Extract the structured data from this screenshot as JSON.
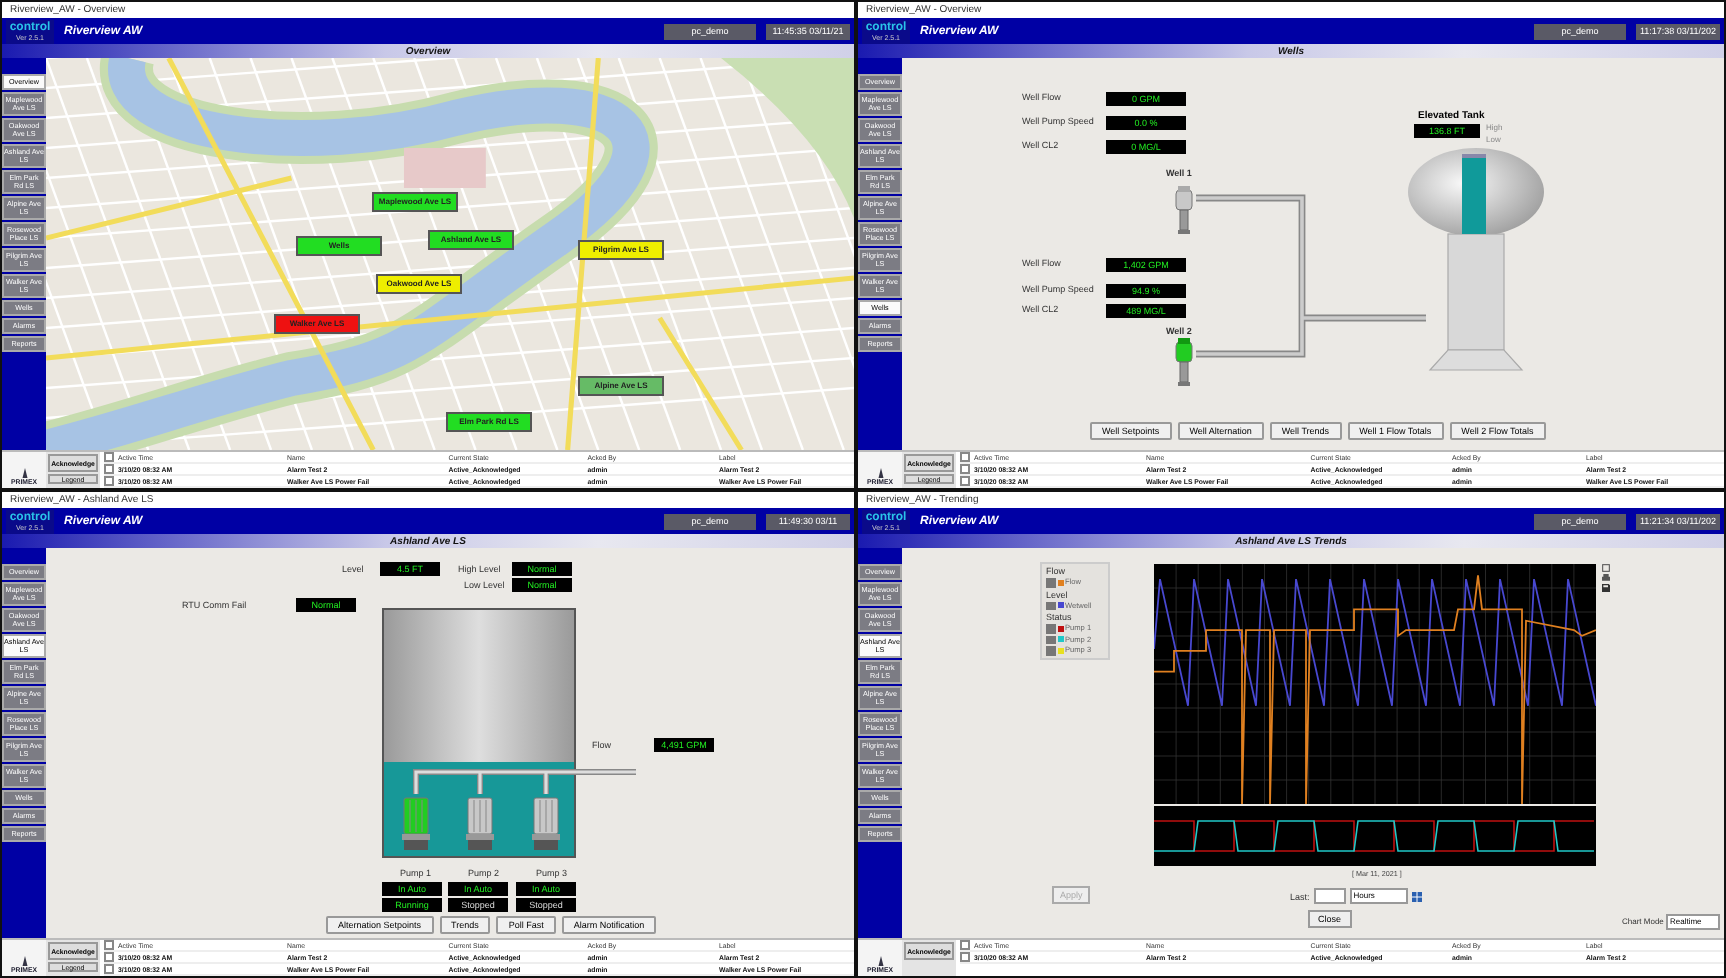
{
  "panels": [
    {
      "window_title": "Riverview_AW - Overview",
      "logo": "control",
      "version": "Ver 2.5.1",
      "app_title": "Riverview AW",
      "user": "pc_demo",
      "clock": "11:45:35  03/11/21",
      "screen_title": "Overview",
      "select_all_checked": false,
      "nav": [
        {
          "label": "Overview",
          "selected": true
        },
        {
          "label": "Maplewood Ave LS",
          "selected": false
        },
        {
          "label": "Oakwood Ave LS",
          "selected": false
        },
        {
          "label": "Ashland Ave LS",
          "selected": false
        },
        {
          "label": "Elm Park Rd LS",
          "selected": false
        },
        {
          "label": "Alpine Ave LS",
          "selected": false
        },
        {
          "label": "Rosewood Place LS",
          "selected": false
        },
        {
          "label": "Pilgrim Ave LS",
          "selected": false
        },
        {
          "label": "Walker Ave LS",
          "selected": false
        },
        {
          "label": "Wells",
          "selected": false
        },
        {
          "label": "Alarms",
          "selected": false
        },
        {
          "label": "Reports",
          "selected": false
        }
      ],
      "content": {
        "kind": "map",
        "stations": [
          {
            "label": "Maplewood Ave LS",
            "color": "#22dd22"
          },
          {
            "label": "Wells",
            "color": "#22dd22"
          },
          {
            "label": "Ashland Ave LS",
            "color": "#22dd22"
          },
          {
            "label": "Oakwood Ave LS",
            "color": "#eeee00"
          },
          {
            "label": "Pilgrim Ave LS",
            "color": "#eeee00"
          },
          {
            "label": "Walker Ave LS",
            "color": "#ee1111"
          },
          {
            "label": "Alpine Ave LS",
            "color": "#66bb66"
          },
          {
            "label": "Elm Park Rd LS",
            "color": "#22dd22"
          }
        ]
      },
      "brand": "PRIMEX",
      "alarm_buttons": [
        "Acknowledge",
        "Legend"
      ],
      "alarm_columns": [
        "Active Time",
        "Name",
        "Current State",
        "Acked By",
        "Label"
      ],
      "alarm_rows": [
        {
          "checked": false,
          "cells": [
            "3/10/20 08:32 AM",
            "Alarm Test 2",
            "Active_Acknowledged",
            "admin",
            "Alarm Test 2"
          ]
        },
        {
          "checked": false,
          "cells": [
            "3/10/20 08:32 AM",
            "Walker Ave LS Power Fail",
            "Active_Acknowledged",
            "admin",
            "Walker Ave LS Power Fail"
          ]
        }
      ]
    },
    {
      "window_title": "Riverview_AW - Overview",
      "logo": "control",
      "version": "Ver 2.5.1",
      "app_title": "Riverview AW",
      "user": "pc_demo",
      "clock": "11:17:38  03/11/202",
      "screen_title": "Wells",
      "select_all_checked": false,
      "nav": [
        {
          "label": "Overview",
          "selected": false
        },
        {
          "label": "Maplewood Ave LS",
          "selected": false
        },
        {
          "label": "Oakwood Ave LS",
          "selected": false
        },
        {
          "label": "Ashland Ave LS",
          "selected": false
        },
        {
          "label": "Elm Park Rd LS",
          "selected": false
        },
        {
          "label": "Alpine Ave LS",
          "selected": false
        },
        {
          "label": "Rosewood Place LS",
          "selected": false
        },
        {
          "label": "Pilgrim Ave LS",
          "selected": false
        },
        {
          "label": "Walker Ave LS",
          "selected": false
        },
        {
          "label": "Wells",
          "selected": true
        },
        {
          "label": "Alarms",
          "selected": false
        },
        {
          "label": "Reports",
          "selected": false
        }
      ],
      "content": {
        "kind": "wells",
        "wells": [
          {
            "name": "Well 1",
            "running": false,
            "readings": [
              {
                "label": "Well Flow",
                "value": "0 GPM"
              },
              {
                "label": "Well Pump Speed",
                "value": "0.0 %"
              },
              {
                "label": "Well CL2",
                "value": "0 MG/L"
              }
            ]
          },
          {
            "name": "Well 2",
            "running": true,
            "readings": [
              {
                "label": "Well Flow",
                "value": "1,402 GPM"
              },
              {
                "label": "Well Pump Speed",
                "value": "94.9 %"
              },
              {
                "label": "Well CL2",
                "value": "489 MG/L"
              }
            ]
          }
        ],
        "tank": {
          "title": "Elevated Tank",
          "value": "136.8 FT",
          "high": "High",
          "low": "Low",
          "level": 0.95
        },
        "buttons": [
          "Well Setpoints",
          "Well Alternation",
          "Well Trends",
          "Well 1 Flow Totals",
          "Well 2 Flow Totals"
        ]
      },
      "brand": "PRIMEX",
      "alarm_buttons": [
        "Acknowledge",
        "Legend"
      ],
      "alarm_columns": [
        "Active Time",
        "Name",
        "Current State",
        "Acked By",
        "Label"
      ],
      "alarm_rows": [
        {
          "checked": false,
          "cells": [
            "3/10/20 08:32 AM",
            "Alarm Test 2",
            "Active_Acknowledged",
            "admin",
            "Alarm Test 2"
          ]
        },
        {
          "checked": false,
          "cells": [
            "3/10/20 08:32 AM",
            "Walker Ave LS Power Fail",
            "Active_Acknowledged",
            "admin",
            "Walker Ave LS Power Fail"
          ]
        }
      ]
    },
    {
      "window_title": "Riverview_AW - Ashland Ave LS",
      "logo": "control",
      "version": "Ver 2.5.1",
      "app_title": "Riverview AW",
      "user": "pc_demo",
      "clock": "11:49:30  03/11",
      "screen_title": "Ashland Ave LS",
      "select_all_checked": false,
      "nav": [
        {
          "label": "Overview",
          "selected": false
        },
        {
          "label": "Maplewood Ave LS",
          "selected": false
        },
        {
          "label": "Oakwood Ave LS",
          "selected": false
        },
        {
          "label": "Ashland Ave LS",
          "selected": true
        },
        {
          "label": "Elm Park Rd LS",
          "selected": false
        },
        {
          "label": "Alpine Ave LS",
          "selected": false
        },
        {
          "label": "Rosewood Place LS",
          "selected": false
        },
        {
          "label": "Pilgrim Ave LS",
          "selected": false
        },
        {
          "label": "Walker Ave LS",
          "selected": false
        },
        {
          "label": "Wells",
          "selected": false
        },
        {
          "label": "Alarms",
          "selected": false
        },
        {
          "label": "Reports",
          "selected": false
        }
      ],
      "content": {
        "kind": "station",
        "level_label": "Level",
        "level_value": "4.5 FT",
        "indicators": [
          {
            "label": "High Level",
            "value": "Normal"
          },
          {
            "label": "Low Level",
            "value": "Normal"
          },
          {
            "label": "RTU Comm Fail",
            "value": "Normal"
          }
        ],
        "flow_label": "Flow",
        "flow_value": "4,491 GPM",
        "wetwell": {
          "level": 0.38
        },
        "pumps": [
          {
            "name": "Pump 1",
            "mode": "In Auto",
            "state": "Running",
            "running": true
          },
          {
            "name": "Pump 2",
            "mode": "In Auto",
            "state": "Stopped",
            "running": false
          },
          {
            "name": "Pump 3",
            "mode": "In Auto",
            "state": "Stopped",
            "running": false
          }
        ],
        "buttons": [
          "Alternation Setpoints",
          "Trends",
          "Poll Fast",
          "Alarm Notification"
        ]
      },
      "brand": "PRIMEX",
      "alarm_buttons": [
        "Acknowledge",
        "Legend"
      ],
      "alarm_columns": [
        "Active Time",
        "Name",
        "Current State",
        "Acked By",
        "Label"
      ],
      "alarm_rows": [
        {
          "checked": false,
          "cells": [
            "3/10/20 08:32 AM",
            "Alarm Test 2",
            "Active_Acknowledged",
            "admin",
            "Alarm Test 2"
          ]
        },
        {
          "checked": false,
          "cells": [
            "3/10/20 08:32 AM",
            "Walker Ave LS Power Fail",
            "Active_Acknowledged",
            "admin",
            "Walker Ave LS Power Fail"
          ]
        }
      ]
    },
    {
      "window_title": "Riverview_AW - Trending",
      "logo": "control",
      "version": "Ver 2.5.1",
      "app_title": "Riverview AW",
      "user": "pc_demo",
      "clock": "11:21:34  03/11/202",
      "screen_title": "Ashland Ave LS Trends",
      "select_all_checked": false,
      "nav": [
        {
          "label": "Overview",
          "selected": false
        },
        {
          "label": "Maplewood Ave LS",
          "selected": false
        },
        {
          "label": "Oakwood Ave LS",
          "selected": false
        },
        {
          "label": "Ashland Ave LS",
          "selected": true
        },
        {
          "label": "Elm Park Rd LS",
          "selected": false
        },
        {
          "label": "Alpine Ave LS",
          "selected": false
        },
        {
          "label": "Rosewood Place LS",
          "selected": false
        },
        {
          "label": "Pilgrim Ave LS",
          "selected": false
        },
        {
          "label": "Walker Ave LS",
          "selected": false
        },
        {
          "label": "Wells",
          "selected": false
        },
        {
          "label": "Alarms",
          "selected": false
        },
        {
          "label": "Reports",
          "selected": false
        }
      ],
      "content": {
        "kind": "trends",
        "legend": [
          {
            "title": "Flow",
            "items": [
              {
                "label": "Flow",
                "color": "#e08020",
                "checked": true
              }
            ]
          },
          {
            "title": "Level",
            "items": [
              {
                "label": "Wetwell",
                "color": "#4848d0",
                "checked": true
              }
            ]
          },
          {
            "title": "Status",
            "items": [
              {
                "label": "Pump 1",
                "color": "#c01010",
                "checked": true
              },
              {
                "label": "Pump 2",
                "color": "#20c8c8",
                "checked": true
              },
              {
                "label": "Pump 3",
                "color": "#e8e020",
                "checked": true
              }
            ]
          }
        ],
        "date": "[ Mar 11, 2021 ]",
        "apply": {
          "label": "Apply",
          "disabled": true
        },
        "last_label": "Last:",
        "units": "Hours",
        "close": "Close",
        "mode_label": "Chart Mode",
        "mode_value": "Realtime"
      },
      "brand": "PRIMEX",
      "alarm_buttons": [
        "Acknowledge"
      ],
      "alarm_columns": [
        "Active Time",
        "Name",
        "Current State",
        "Acked By",
        "Label"
      ],
      "alarm_rows": [
        {
          "checked": false,
          "cells": [
            "3/10/20 08:32 AM",
            "Alarm Test 2",
            "Active_Acknowledged",
            "admin",
            "Alarm Test 2"
          ]
        }
      ]
    }
  ]
}
